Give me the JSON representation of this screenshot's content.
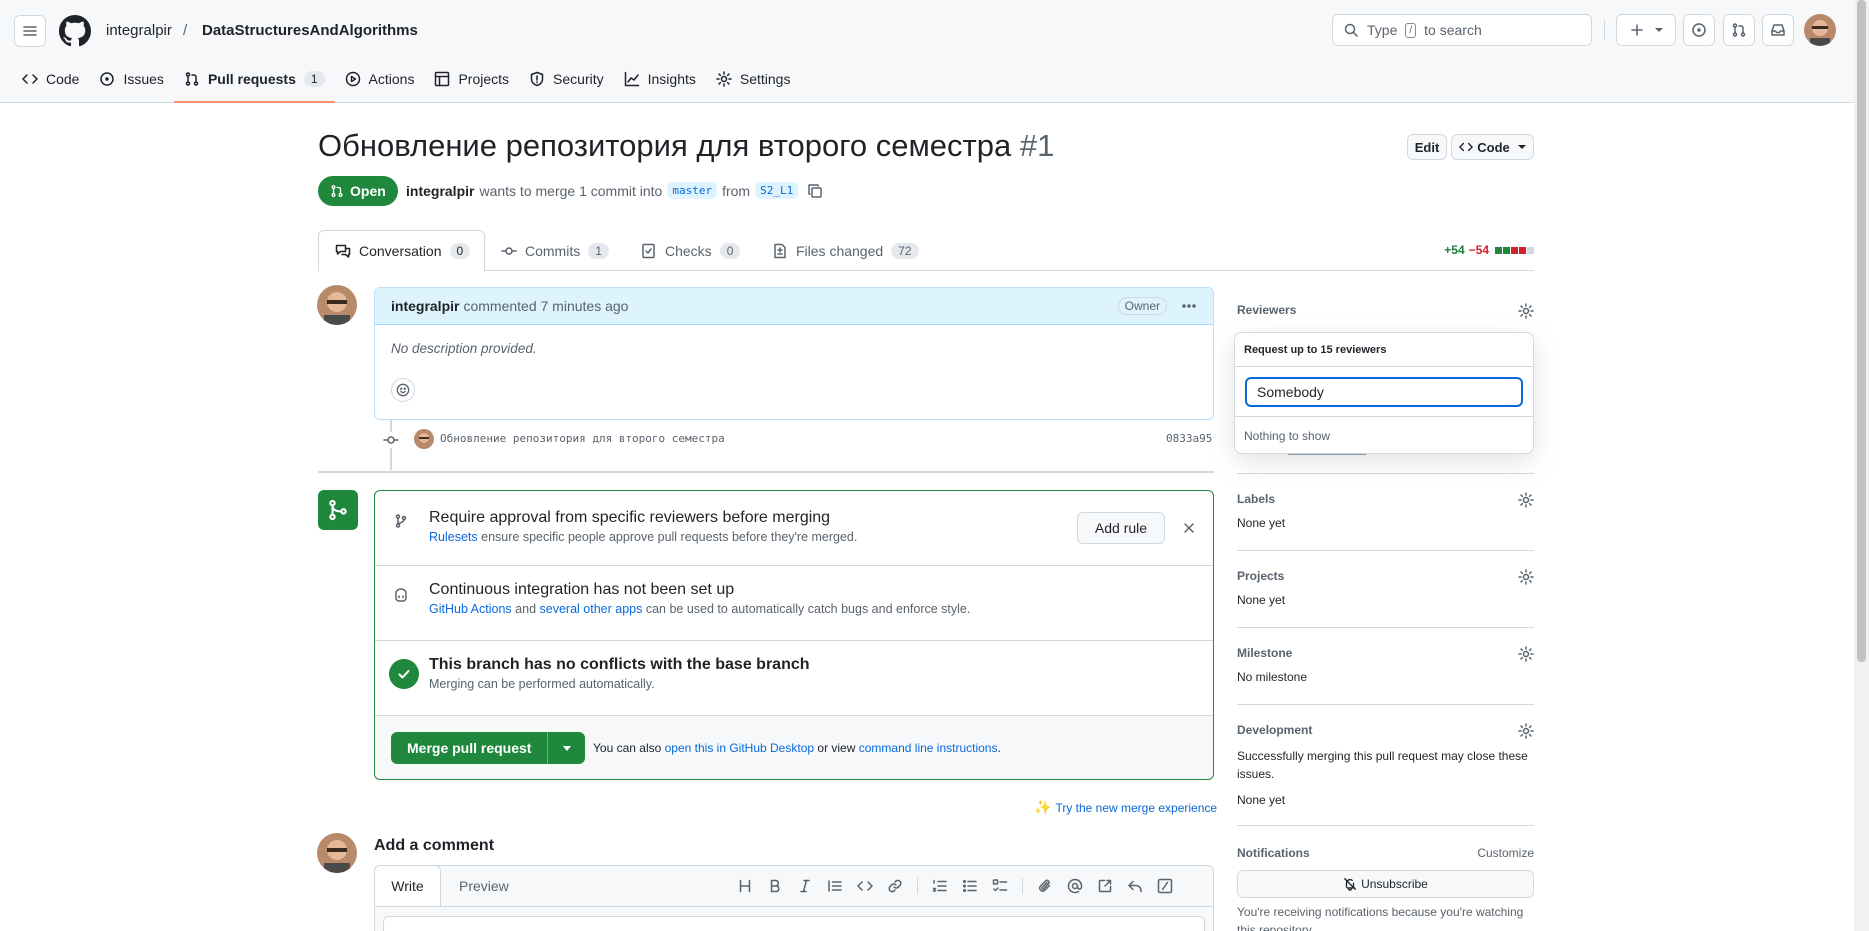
{
  "header": {
    "owner": "integralpir",
    "separator": "/",
    "repo": "DataStructuresAndAlgorithms",
    "search_prefix": "Type",
    "search_key": "/",
    "search_suffix": "to search"
  },
  "repo_nav": [
    {
      "label": "Code",
      "icon": "code-icon"
    },
    {
      "label": "Issues",
      "icon": "issue-icon"
    },
    {
      "label": "Pull requests",
      "icon": "pull-request-icon",
      "count": "1",
      "active": true
    },
    {
      "label": "Actions",
      "icon": "play-icon"
    },
    {
      "label": "Projects",
      "icon": "table-icon"
    },
    {
      "label": "Security",
      "icon": "shield-icon"
    },
    {
      "label": "Insights",
      "icon": "graph-icon"
    },
    {
      "label": "Settings",
      "icon": "gear-icon"
    }
  ],
  "pr": {
    "title": "Обновление репозитория для второго семестра",
    "number": "#1",
    "edit_label": "Edit",
    "code_label": "Code",
    "state": "Open",
    "author": "integralpir",
    "merge_text": "wants to merge 1 commit into",
    "base_branch": "master",
    "from_text": "from",
    "head_branch": "S2_L1"
  },
  "tabs": [
    {
      "label": "Conversation",
      "count": "0"
    },
    {
      "label": "Commits",
      "count": "1"
    },
    {
      "label": "Checks",
      "count": "0"
    },
    {
      "label": "Files changed",
      "count": "72"
    }
  ],
  "diffstat": {
    "additions": "+54",
    "deletions": "−54"
  },
  "comment": {
    "author": "integralpir",
    "action": "commented 7 minutes ago",
    "role": "Owner",
    "body": "No description provided."
  },
  "commit": {
    "message": "Обновление репозитория для второго семестра",
    "sha": "0833a95"
  },
  "merge": {
    "ruleset_title": "Require approval from specific reviewers before merging",
    "ruleset_link": "Rulesets",
    "ruleset_sub": "ensure specific people approve pull requests before they're merged.",
    "add_rule_label": "Add rule",
    "ci_title": "Continuous integration has not been set up",
    "ci_link1": "GitHub Actions",
    "ci_and": "and",
    "ci_link2": "several other apps",
    "ci_sub": "can be used to automatically catch bugs and enforce style.",
    "conflict_title": "This branch has no conflicts with the base branch",
    "conflict_sub": "Merging can be performed automatically.",
    "merge_button": "Merge pull request",
    "also_text": "You can also",
    "desktop_link": "open this in GitHub Desktop",
    "or_view": "or view",
    "cli_link": "command line instructions",
    "period": ".",
    "try_new": "Try the new merge experience"
  },
  "add_comment": {
    "title": "Add a comment",
    "write_tab": "Write",
    "preview_tab": "Preview"
  },
  "sidebar": {
    "reviewers": "Reviewers",
    "popover_title": "Request up to 15 reviewers",
    "popover_input": "Somebody",
    "popover_empty": "Nothing to show",
    "labels": "Labels",
    "labels_value": "None yet",
    "projects": "Projects",
    "projects_value": "None yet",
    "milestone": "Milestone",
    "milestone_value": "No milestone",
    "development": "Development",
    "development_desc": "Successfully merging this pull request may close these issues.",
    "development_value": "None yet",
    "notifications": "Notifications",
    "customize": "Customize",
    "unsubscribe": "Unsubscribe",
    "notif_reason": "You're receiving notifications because you're watching this repository."
  },
  "colors": {
    "accent": "#0969da",
    "success": "#1f883d",
    "danger": "#cf222e",
    "nav_underline": "#fd8c73"
  }
}
